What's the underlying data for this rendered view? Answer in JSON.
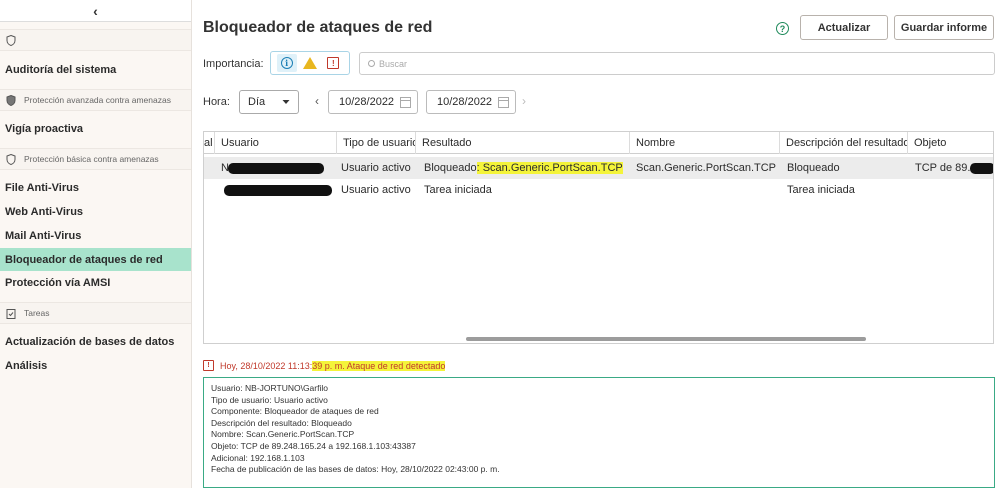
{
  "sidebar": {
    "collapse_glyph": "‹",
    "items": [
      {
        "type": "group",
        "label": "",
        "icon": "shield-icon"
      },
      {
        "type": "item",
        "label": "Auditoría del sistema"
      },
      {
        "type": "group",
        "label": "Protección avanzada contra amenazas",
        "icon": "shield-icon"
      },
      {
        "type": "item",
        "label": "Vigía proactiva"
      },
      {
        "type": "group",
        "label": "Protección básica contra amenazas",
        "icon": "shield-icon"
      },
      {
        "type": "item",
        "label": "File Anti-Virus"
      },
      {
        "type": "item",
        "label": "Web Anti-Virus"
      },
      {
        "type": "item",
        "label": "Mail Anti-Virus"
      },
      {
        "type": "item",
        "label": "Bloqueador de ataques de red",
        "active": true
      },
      {
        "type": "item",
        "label": "Protección vía AMSI"
      },
      {
        "type": "group",
        "label": "Tareas",
        "icon": "tasks-icon"
      },
      {
        "type": "item",
        "label": "Actualización de bases de datos"
      },
      {
        "type": "item",
        "label": "Análisis"
      }
    ]
  },
  "header": {
    "title": "Bloqueador de ataques de red",
    "help_glyph": "?",
    "refresh_label": "Actualizar",
    "save_report_label": "Guardar informe"
  },
  "filters": {
    "importance_label": "Importancia:",
    "info_glyph": "i",
    "error_glyph": "!",
    "search_placeholder": "Buscar",
    "time_label": "Hora:",
    "period_value": "Día",
    "date_from": "10/28/2022",
    "date_to": "10/28/2022",
    "prev_glyph": "‹",
    "next_glyph": "›"
  },
  "table": {
    "columns": [
      "al",
      "Usuario",
      "Tipo de usuario",
      "Resultado",
      "Nombre",
      "Descripción del resultado",
      "Objeto"
    ],
    "rows": [
      {
        "selected": true,
        "user": "N",
        "user_type": "Usuario activo",
        "result_prefix": "Bloqueado",
        "result_highlight": ": Scan.Generic.PortScan.TCP",
        "name": "Scan.Generic.PortScan.TCP",
        "description": "Bloqueado",
        "object": "TCP de 89.2"
      },
      {
        "selected": false,
        "user": "",
        "user_type": "Usuario activo",
        "result_prefix": "Tarea iniciada",
        "result_highlight": "",
        "name": "",
        "description": "Tarea iniciada",
        "object": ""
      }
    ]
  },
  "detail": {
    "header_prefix": "Hoy, 28/10/2022 11:13:",
    "header_highlight": "39 p. m. Ataque de red detectado",
    "lines": [
      "Usuario: NB-JORTUNO\\Garfilo",
      "Tipo de usuario: Usuario activo",
      "Componente: Bloqueador de ataques de red",
      "Descripción del resultado: Bloqueado",
      "Nombre: Scan.Generic.PortScan.TCP",
      "Objeto: TCP de 89.248.165.24 a 192.168.1.103:43387",
      "Adicional: 192.168.1.103",
      "Fecha de publicación de las bases de datos: Hoy, 28/10/2022 02:43:00 p. m."
    ]
  },
  "colors": {
    "accent": "#1f8a5b",
    "active_item": "#a8e3cc",
    "highlight": "#f4f43a",
    "error": "#c0392b"
  }
}
